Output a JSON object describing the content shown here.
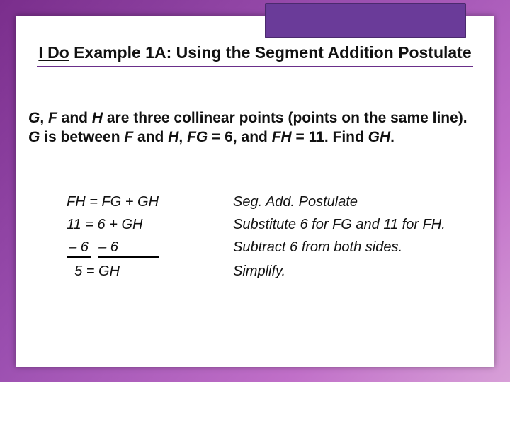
{
  "title": {
    "ido": "I Do",
    "rest": " Example 1A: Using the Segment Addition Postulate"
  },
  "problem": {
    "p1a": "G",
    "p1b": ", ",
    "p1c": "F",
    "p1d": " and ",
    "p1e": "H",
    "p1f": " are three collinear points (points on the same line). ",
    "p1g": "G",
    "p1h": " is between ",
    "p1i": "F",
    "p1j": " and ",
    "p1k": "H",
    "p1l": ", ",
    "p1m": "FG",
    "p1n": " = 6, and ",
    "p1o": "FH",
    "p1p": " = 11.  Find ",
    "p1q": "GH",
    "p1r": "."
  },
  "steps": [
    {
      "eq": "FH = FG + GH",
      "reason": "Seg. Add. Postulate"
    },
    {
      "eq": "11 = 6 + GH",
      "reason": "Substitute 6 for FG and 11 for FH."
    },
    {
      "eq_l": "– 6",
      "eq_r": "– 6",
      "reason": "Subtract 6 from both sides."
    },
    {
      "eq": "  5 = GH",
      "reason": "Simplify."
    }
  ]
}
